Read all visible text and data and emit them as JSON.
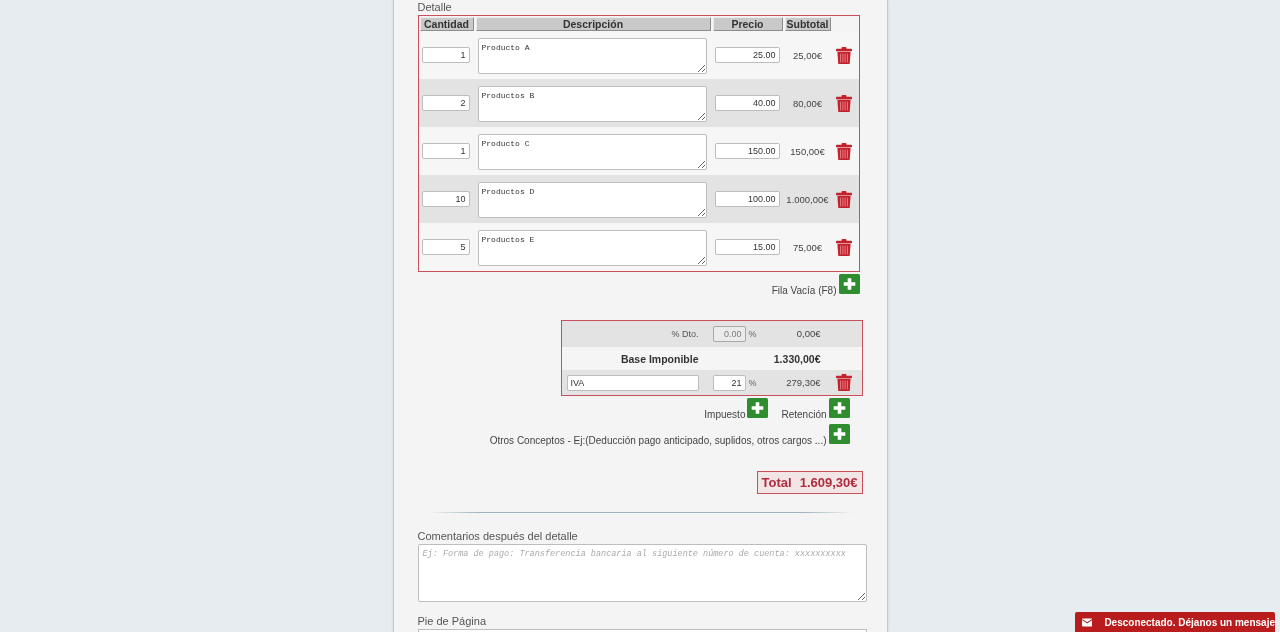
{
  "detail": {
    "label": "Detalle",
    "columns": [
      "Cantidad",
      "Descripción",
      "Precio",
      "Subtotal"
    ],
    "rows": [
      {
        "quantity": "1",
        "description": "Producto A",
        "price": "25.00",
        "subtotal": "25,00€"
      },
      {
        "quantity": "2",
        "description": "Productos B",
        "price": "40.00",
        "subtotal": "80,00€"
      },
      {
        "quantity": "1",
        "description": "Producto C",
        "price": "150.00",
        "subtotal": "150,00€"
      },
      {
        "quantity": "10",
        "description": "Productos D",
        "price": "100.00",
        "subtotal": "1.000,00€"
      },
      {
        "quantity": "5",
        "description": "Productos E",
        "price": "15.00",
        "subtotal": "75,00€"
      }
    ]
  },
  "add_row": {
    "label": "Fila Vacía (F8)"
  },
  "totals": {
    "discount": {
      "label": "% Dto.",
      "value": "0.00",
      "disabled": true,
      "unit": "%",
      "amount": "0,00€"
    },
    "base": {
      "label": "Base Imponible",
      "amount": "1.330,00€"
    },
    "taxes": [
      {
        "name": "IVA",
        "rate": "21",
        "unit": "%",
        "amount": "279,30€"
      }
    ]
  },
  "actions": [
    {
      "label": "Impuesto"
    },
    {
      "label": "Retención"
    }
  ],
  "other_concepts": {
    "label": "Otros Conceptos - Ej:(Deducción pago anticipado, suplidos, otros cargos ...)"
  },
  "total": {
    "label": "Total",
    "amount": "1.609,30€"
  },
  "comments": {
    "label": "Comentarios después del detalle",
    "placeholder": "Ej: Forma de pago: Transferencia bancaria al siguiente número de cuenta: xxxxxxxxxx"
  },
  "footer": {
    "label": "Pie de Página"
  },
  "chat": {
    "text": "Desconectado. Déjanos un mensaje"
  }
}
